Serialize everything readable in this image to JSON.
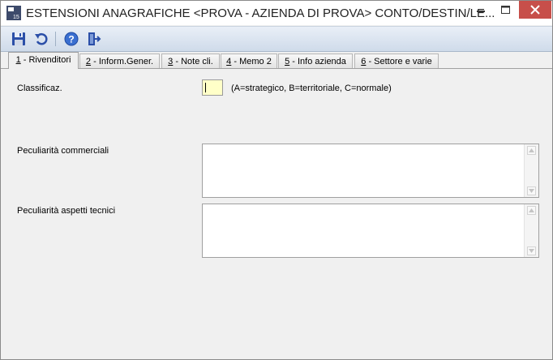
{
  "window": {
    "title": "ESTENSIONI ANAGRAFICHE <PROVA - AZIENDA DI PROVA> CONTO/DESTIN/LE...",
    "app_icon_text": "15"
  },
  "toolbar": {
    "buttons": [
      "save-icon",
      "undo-icon",
      "help-icon",
      "exit-icon"
    ]
  },
  "tabs": [
    {
      "key": "1",
      "label": " - Rivenditori",
      "active": true
    },
    {
      "key": "2",
      "label": " - Inform.Gener.",
      "active": false
    },
    {
      "key": "3",
      "label": " - Note cli.",
      "active": false
    },
    {
      "key": "4",
      "label": " - Memo 2",
      "active": false
    },
    {
      "key": "5",
      "label": " - Info azienda",
      "active": false
    },
    {
      "key": "6",
      "label": " - Settore e varie",
      "active": false
    }
  ],
  "form": {
    "classificaz_label": "Classificaz.",
    "classificaz_value": "",
    "classificaz_hint": "(A=strategico, B=territoriale, C=normale)",
    "commerciali_label": "Peculiarità commerciali",
    "commerciali_value": "",
    "tecnici_label": "Peculiarità aspetti tecnici",
    "tecnici_value": ""
  },
  "colors": {
    "input_highlight": "#ffffc8",
    "close_button": "#c74f4a"
  }
}
